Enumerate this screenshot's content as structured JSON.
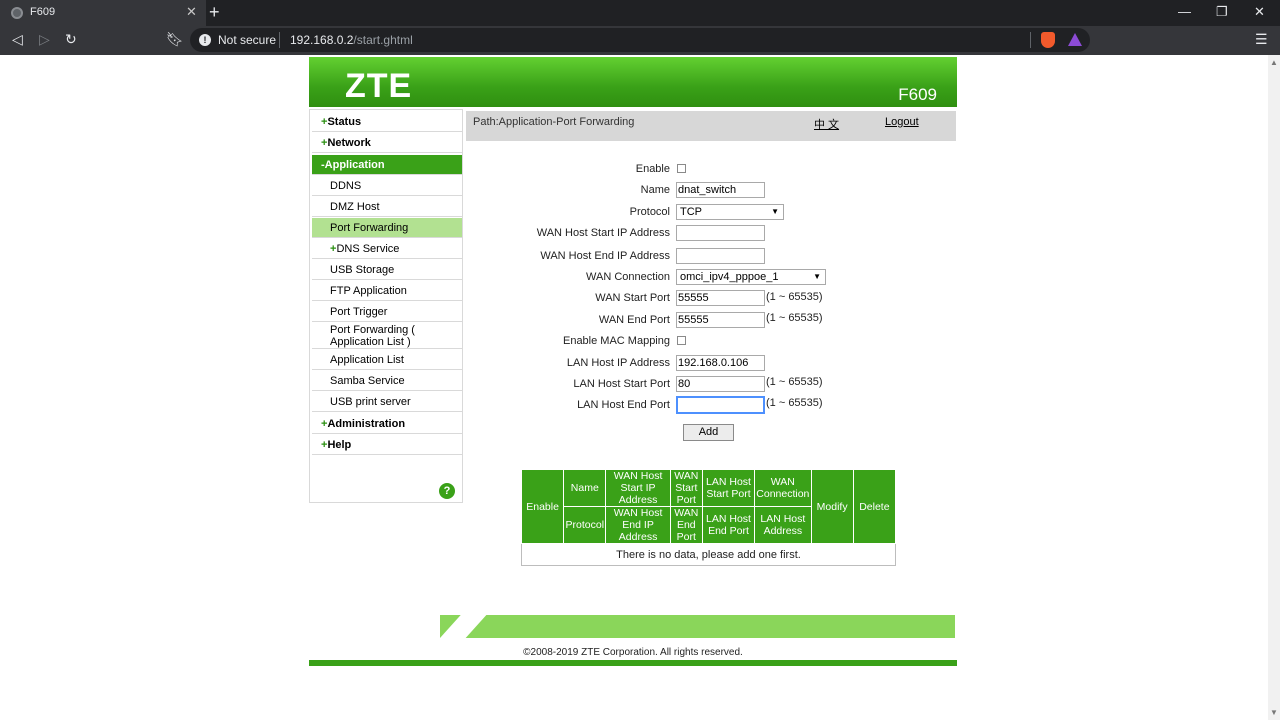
{
  "browser": {
    "tab_title": "F609",
    "not_secure": "Not secure",
    "url_host": "192.168.0.2",
    "url_path": "/start.ghtml"
  },
  "banner": {
    "logo": "ZTE",
    "model": "F609"
  },
  "sidebar": {
    "top_items": [
      {
        "label": "Status"
      },
      {
        "label": "Network"
      },
      {
        "label": "Application"
      },
      {
        "label": "Administration"
      },
      {
        "label": "Help"
      }
    ],
    "sub_items": [
      {
        "label": "DDNS"
      },
      {
        "label": "DMZ Host"
      },
      {
        "label": "Port Forwarding"
      },
      {
        "label": "DNS Service"
      },
      {
        "label": "USB Storage"
      },
      {
        "label": "FTP Application"
      },
      {
        "label": "Port Trigger"
      },
      {
        "label": "Port Forwarding ( Application List )"
      },
      {
        "label": "Application List"
      },
      {
        "label": "Samba Service"
      },
      {
        "label": "USB print server"
      }
    ],
    "help_symbol": "?"
  },
  "pathbar": {
    "path": "Path:Application-Port Forwarding",
    "language": "中 文",
    "logout": "Logout"
  },
  "form": {
    "enable_label": "Enable",
    "enable_checked": false,
    "name_label": "Name",
    "name_value": "dnat_switch",
    "protocol_label": "Protocol",
    "protocol_value": "TCP",
    "wan_host_start_ip_label": "WAN Host Start IP Address",
    "wan_host_start_ip_value": "",
    "wan_host_end_ip_label": "WAN Host End IP Address",
    "wan_host_end_ip_value": "",
    "wan_connection_label": "WAN Connection",
    "wan_connection_value": "omci_ipv4_pppoe_1",
    "wan_start_port_label": "WAN Start Port",
    "wan_start_port_value": "55555",
    "wan_end_port_label": "WAN End Port",
    "wan_end_port_value": "55555",
    "enable_mac_mapping_label": "Enable MAC Mapping",
    "enable_mac_mapping_checked": false,
    "lan_host_ip_label": "LAN Host IP Address",
    "lan_host_ip_value": "192.168.0.106",
    "lan_host_start_port_label": "LAN Host Start Port",
    "lan_host_start_port_value": "80",
    "lan_host_end_port_label": "LAN Host End Port",
    "lan_host_end_port_value": "",
    "port_range_hint": "(1 ~ 65535)",
    "add_button": "Add"
  },
  "table": {
    "headers_row1": [
      "Enable",
      "Name",
      "WAN Host Start IP Address",
      "WAN Start Port",
      "LAN Host Start Port",
      "WAN Connection",
      "Modify",
      "Delete"
    ],
    "headers_row2": [
      "Protocol",
      "WAN Host End IP Address",
      "WAN End Port",
      "LAN Host End Port",
      "LAN Host Address"
    ],
    "empty_message": "There is no data, please add one first."
  },
  "footer": {
    "copyright": "©2008-2019 ZTE Corporation. All rights reserved."
  },
  "colors": {
    "brand_green": "#3aa118",
    "selected_green": "#b2e191",
    "footer_green": "#8ad65a"
  }
}
